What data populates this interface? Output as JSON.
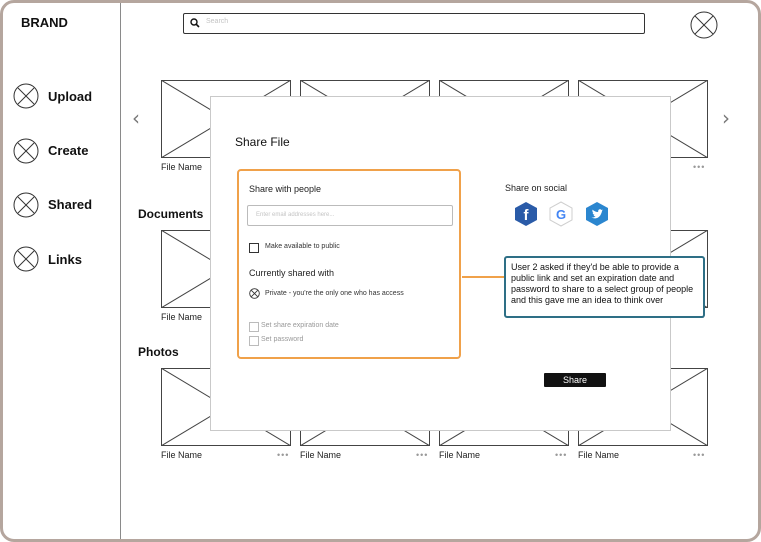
{
  "brand": "BRAND",
  "search": {
    "placeholder": "Search"
  },
  "nav": [
    {
      "label": "Upload"
    },
    {
      "label": "Create"
    },
    {
      "label": "Shared"
    },
    {
      "label": "Links"
    }
  ],
  "sections": {
    "documents": "Documents",
    "photos": "Photos"
  },
  "files": {
    "row1": [
      "File Name",
      "",
      "",
      ""
    ],
    "row2": [
      "File Name",
      "",
      "",
      ""
    ],
    "row3": [
      "File Name",
      "File Name",
      "File Name",
      "File Name"
    ]
  },
  "more_glyph": "•••",
  "modal": {
    "title": "Share File",
    "share_with_people": "Share with people",
    "email_placeholder": "Enter email addresses here...",
    "make_public": "Make available to public",
    "currently_shared": "Currently shared with",
    "private_text": "Private - you're the only one who has access",
    "expiration": "Set share expiration date",
    "password": "Set password",
    "share_on_social": "Share on social",
    "share_button": "Share",
    "social_icons": [
      "facebook-icon",
      "google-icon",
      "twitter-icon"
    ]
  },
  "annotation": "User 2 asked if they'd be able to provide a public link and set an expiration date and password to share to a select group of people and this gave me an idea to think over",
  "colors": {
    "frame": "#b5a69e",
    "highlight_orange": "#f0a14a",
    "annotation_blue": "#2e6f86",
    "facebook": "#2a5ba8",
    "twitter": "#2b86cf"
  }
}
